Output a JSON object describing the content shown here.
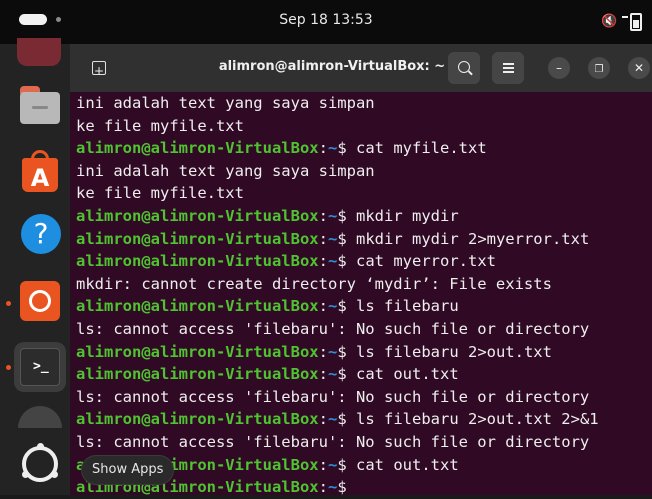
{
  "topbar": {
    "datetime": "Sep 18  13:53"
  },
  "window": {
    "title": "alimron@alimron-VirtualBox: ~"
  },
  "terminal": {
    "lines": [
      {
        "type": "out",
        "text": "ini adalah text yang saya simpan"
      },
      {
        "type": "out",
        "text": "ke file myfile.txt"
      },
      {
        "type": "cmd",
        "user": "alimron@alimron-VirtualBox",
        "sep": ":",
        "path": "~",
        "prompt": "$ ",
        "cmd": "cat myfile.txt"
      },
      {
        "type": "out",
        "text": "ini adalah text yang saya simpan"
      },
      {
        "type": "out",
        "text": "ke file myfile.txt"
      },
      {
        "type": "cmd",
        "user": "alimron@alimron-VirtualBox",
        "sep": ":",
        "path": "~",
        "prompt": "$ ",
        "cmd": "mkdir mydir"
      },
      {
        "type": "cmd",
        "user": "alimron@alimron-VirtualBox",
        "sep": ":",
        "path": "~",
        "prompt": "$ ",
        "cmd": "mkdir mydir 2>myerror.txt"
      },
      {
        "type": "cmd",
        "user": "alimron@alimron-VirtualBox",
        "sep": ":",
        "path": "~",
        "prompt": "$ ",
        "cmd": "cat myerror.txt"
      },
      {
        "type": "out",
        "text": "mkdir: cannot create directory ‘mydir’: File exists"
      },
      {
        "type": "cmd",
        "user": "alimron@alimron-VirtualBox",
        "sep": ":",
        "path": "~",
        "prompt": "$ ",
        "cmd": "ls filebaru"
      },
      {
        "type": "out",
        "text": "ls: cannot access 'filebaru': No such file or directory"
      },
      {
        "type": "cmd",
        "user": "alimron@alimron-VirtualBox",
        "sep": ":",
        "path": "~",
        "prompt": "$ ",
        "cmd": "ls filebaru 2>out.txt"
      },
      {
        "type": "cmd",
        "user": "alimron@alimron-VirtualBox",
        "sep": ":",
        "path": "~",
        "prompt": "$ ",
        "cmd": "cat out.txt"
      },
      {
        "type": "out",
        "text": "ls: cannot access 'filebaru': No such file or directory"
      },
      {
        "type": "cmd",
        "user": "alimron@alimron-VirtualBox",
        "sep": ":",
        "path": "~",
        "prompt": "$ ",
        "cmd": "ls filebaru 2>out.txt 2>&1"
      },
      {
        "type": "out",
        "text": "ls: cannot access 'filebaru': No such file or directory"
      },
      {
        "type": "cmd",
        "user": "alimron@alimron-VirtualBox",
        "sep": ":",
        "path": "~",
        "prompt": "$ ",
        "cmd": "cat out.txt"
      },
      {
        "type": "cmd",
        "user": "alimron@alimron-VirtualBox",
        "sep": ":",
        "path": "~",
        "prompt": "$ ",
        "cmd": ""
      }
    ]
  },
  "tooltip": {
    "text": "Show Apps"
  },
  "colors": {
    "terminal_bg": "#300a24",
    "user": "#4fc331",
    "path": "#2f8fd8",
    "accent": "#e95420"
  },
  "icons": [
    "new-tab-icon",
    "search-icon",
    "hamburger-menu-icon",
    "minimize-icon",
    "maximize-icon",
    "close-icon",
    "sound-muted-icon",
    "battery-icon"
  ]
}
